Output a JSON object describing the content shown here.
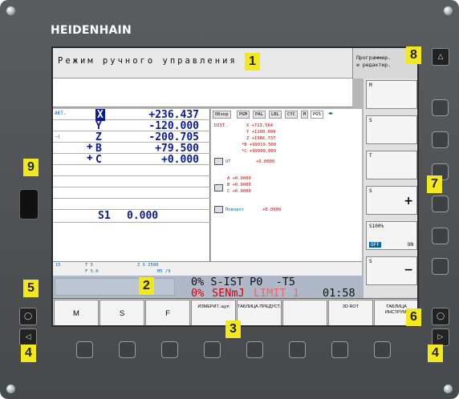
{
  "brand": "HEIDENHAIN",
  "title": "Режим ручного управления",
  "mode_box": {
    "line1": "Программир.",
    "line2": "и редактир."
  },
  "left_header": "АКТ.",
  "positions": [
    {
      "axis": "X",
      "value": "+236.437"
    },
    {
      "axis": "Y",
      "value": "-120.000"
    },
    {
      "axis": "Z",
      "value": "-200.705"
    },
    {
      "axis": "B",
      "value": "+79.500"
    },
    {
      "axis": "C",
      "value": "+0.000"
    }
  ],
  "spindle": {
    "label": "S1",
    "value": "0.000"
  },
  "tabs": [
    "Обзор",
    "PGM",
    "PAL",
    "LBL",
    "CYC",
    "M",
    "POS"
  ],
  "dist": {
    "label": "DIST.",
    "lines": [
      "X   +713.564",
      "Y  +1100.000",
      "Z  +1986.737",
      "*B +99919.500",
      "*C +99999.000"
    ]
  },
  "ut": {
    "label": "UT",
    "value": "+0.0000"
  },
  "abc": [
    "A  +0.0000",
    "B  +0.0000",
    "C  +0.0000"
  ],
  "rotation": {
    "label": "Поворот",
    "value": "+0.0000"
  },
  "status": {
    "t_label": "T 5",
    "z_s": "Z S 2500",
    "f_label": "F 5.0",
    "m_label": "M5 /9",
    "feed": "15"
  },
  "bottom_lines": {
    "line1": "0% S-IST P0  -T5",
    "line2_pct": "0%",
    "line2_unit": "SENmJ",
    "line2_limit": "LIMIT 1",
    "line2_time": "01:58"
  },
  "softkeys": [
    {
      "label": "M"
    },
    {
      "label": "S"
    },
    {
      "label": "F"
    },
    {
      "label": "ИЗМЕРИТ. щуп"
    },
    {
      "label": "ТАБЛИЦА ПРЕДУСТ."
    },
    {
      "label": ""
    },
    {
      "label": "3D ROT"
    },
    {
      "label": "ТАБЛИЦА ИНСТРУМ."
    }
  ],
  "vertical_softkeys": [
    "M",
    "S",
    "T",
    "S",
    "S100%",
    "S"
  ],
  "vs_off_on": {
    "off": "OFF",
    "on": "ON"
  },
  "badges": [
    "1",
    "2",
    "3",
    "4",
    "4",
    "5",
    "6",
    "7",
    "8",
    "9"
  ]
}
